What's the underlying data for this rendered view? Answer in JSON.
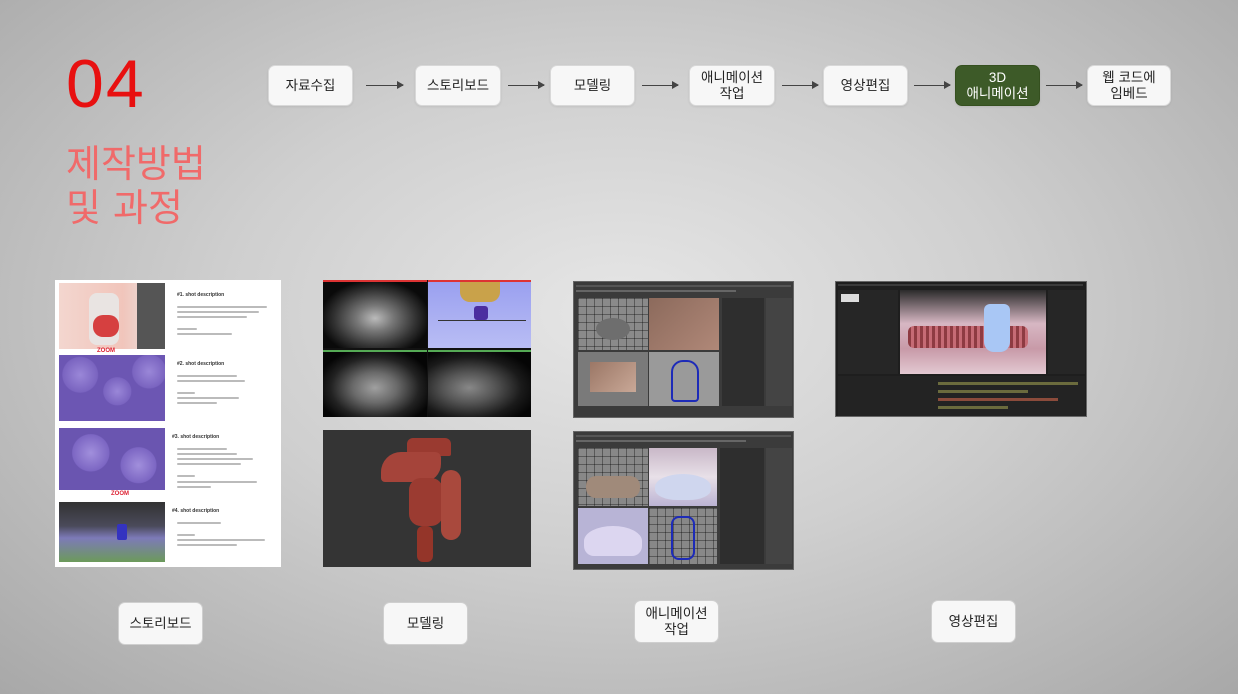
{
  "section": {
    "number": "04",
    "title_lines": [
      "제작방법",
      "및 과정"
    ]
  },
  "process": {
    "steps": [
      {
        "label": "자료수집",
        "active": false
      },
      {
        "label": "스토리보드",
        "active": false
      },
      {
        "label": "모델링",
        "active": false
      },
      {
        "label": "애니메이션\n작업",
        "active": false
      },
      {
        "label": "영상편집",
        "active": false
      },
      {
        "label": "3D\n애니메이션",
        "active": true
      },
      {
        "label": "웹 코드에\n임베드",
        "active": false
      }
    ],
    "active_color": "#3d5a28"
  },
  "storyboard_doc": {
    "shots": [
      "#1. shot description",
      "#2. shot description",
      "#3. shot description",
      "#4. shot description"
    ],
    "zoom_label": "ZOOM"
  },
  "galleries": {
    "storyboard_label": "스토리보드",
    "modeling_label": "모델링",
    "animation_label": "애니메이션\n작업",
    "editing_label": "영상편집"
  },
  "colors": {
    "number": "#e81010",
    "title": "#f06a6a"
  }
}
